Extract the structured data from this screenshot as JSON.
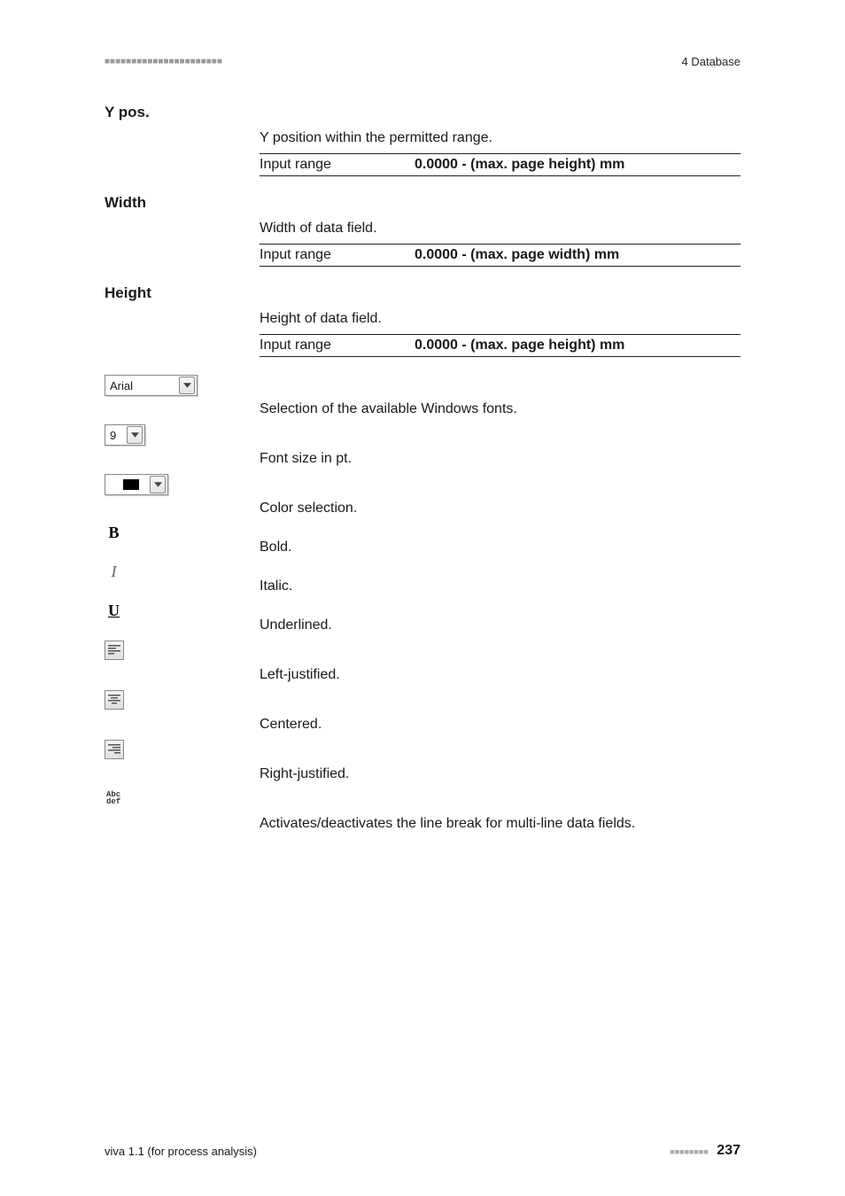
{
  "header": {
    "section": "4 Database"
  },
  "entries": {
    "ypos": {
      "label": "Y pos.",
      "desc": "Y position within the permitted range.",
      "range_label": "Input range",
      "range_value": "0.0000 - (max. page height) mm"
    },
    "width": {
      "label": "Width",
      "desc": "Width of data field.",
      "range_label": "Input range",
      "range_value": "0.0000 - (max. page width) mm"
    },
    "height": {
      "label": "Height",
      "desc": "Height of data field.",
      "range_label": "Input range",
      "range_value": "0.0000 - (max. page height) mm"
    },
    "font": {
      "value": "Arial",
      "desc": "Selection of the available Windows fonts."
    },
    "size": {
      "value": "9",
      "desc": "Font size in pt."
    },
    "color": {
      "desc": "Color selection."
    },
    "bold": {
      "glyph": "B",
      "desc": "Bold."
    },
    "italic": {
      "glyph": "I",
      "desc": "Italic."
    },
    "underline": {
      "glyph": "U",
      "desc": "Underlined."
    },
    "left": {
      "desc": "Left-justified."
    },
    "center": {
      "desc": "Centered."
    },
    "right": {
      "desc": "Right-justified."
    },
    "wrap": {
      "line1": "Abc",
      "line2": "def",
      "desc": "Activates/deactivates the line break for multi-line data fields."
    }
  },
  "footer": {
    "product": "viva 1.1 (for process analysis)",
    "page": "237"
  }
}
